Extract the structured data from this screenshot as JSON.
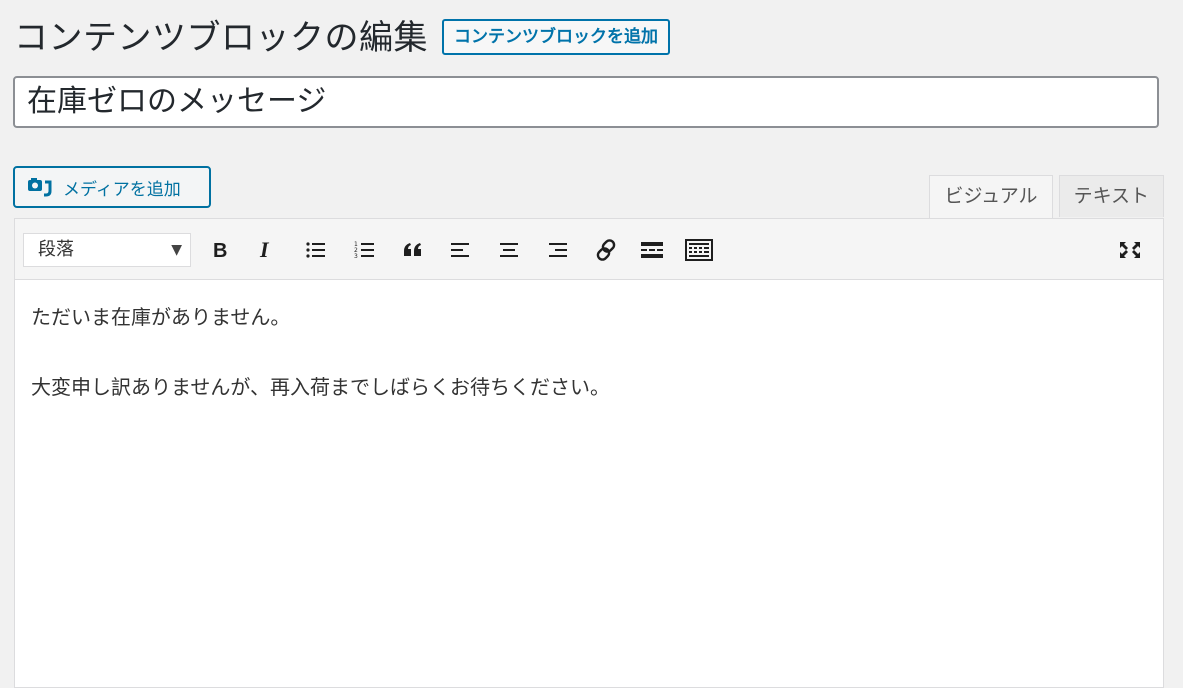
{
  "header": {
    "title": "コンテンツブロックの編集",
    "add_new_label": "コンテンツブロックを追加"
  },
  "post_title": "在庫ゼロのメッセージ",
  "media_button": {
    "label": "メディアを追加",
    "icon": "add-media-icon"
  },
  "tabs": [
    {
      "label": "ビジュアル",
      "active": true
    },
    {
      "label": "テキスト",
      "active": false
    }
  ],
  "toolbar": {
    "format_value": "段落",
    "buttons": [
      "bold",
      "italic",
      "bulleted-list",
      "numbered-list",
      "blockquote",
      "align-left",
      "align-center",
      "align-right",
      "link",
      "read-more",
      "toolbar-toggle",
      "fullscreen"
    ]
  },
  "content": {
    "paragraphs": [
      "ただいま在庫がありません。",
      "大変申し訳ありませんが、再入荷までしばらくお待ちください。"
    ]
  },
  "colors": {
    "accent": "#0073aa",
    "background": "#f1f1f1"
  }
}
